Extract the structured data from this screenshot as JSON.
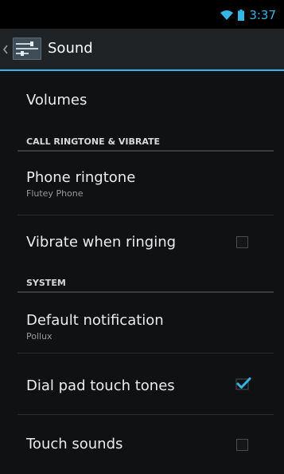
{
  "status_bar": {
    "time": "3:37",
    "wifi_icon": "wifi-icon",
    "battery_icon": "battery-icon"
  },
  "action_bar": {
    "title": "Sound",
    "icon": "settings-icon"
  },
  "items": {
    "volumes": {
      "title": "Volumes"
    },
    "phone_ringtone": {
      "title": "Phone ringtone",
      "summary": "Flutey Phone"
    },
    "vibrate_when_ringing": {
      "title": "Vibrate when ringing",
      "checked": false
    },
    "default_notification": {
      "title": "Default notification",
      "summary": "Pollux"
    },
    "dial_pad_touch_tones": {
      "title": "Dial pad touch tones",
      "checked": true
    },
    "touch_sounds": {
      "title": "Touch sounds",
      "checked": false
    }
  },
  "categories": {
    "call": "CALL RINGTONE & VIBRATE",
    "system": "SYSTEM"
  },
  "colors": {
    "accent": "#33b5e5",
    "background": "#0f1112",
    "action_bar": "#202326"
  }
}
